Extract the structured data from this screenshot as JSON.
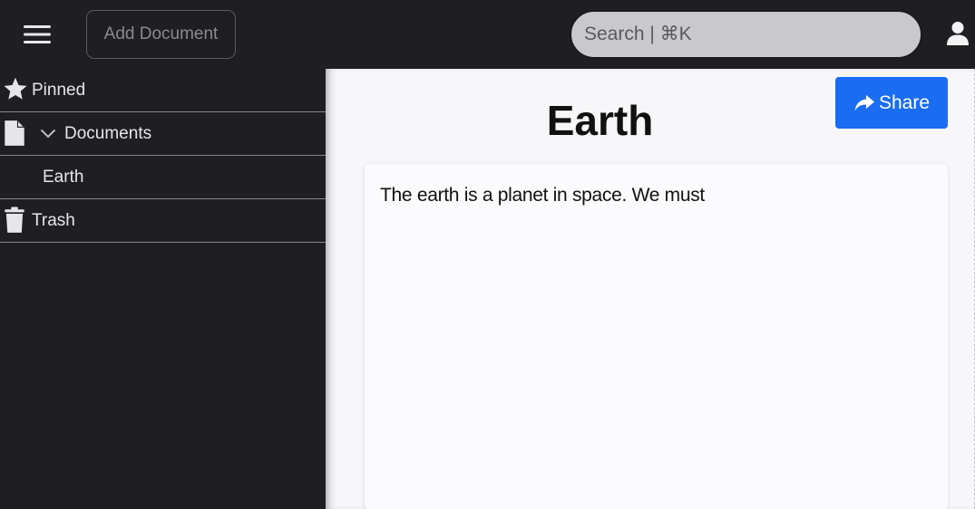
{
  "topbar": {
    "menu_icon": "hamburger-menu-icon",
    "add_document_label": "Add Document",
    "search_placeholder": "Search | ⌘K",
    "user_icon": "user-icon"
  },
  "sidebar": {
    "items": [
      {
        "icon": "star-icon",
        "label": "Pinned"
      },
      {
        "icon": "document-icon",
        "label": "Documents",
        "chevron": "chevron-down-icon",
        "expanded": true
      },
      {
        "label": "Earth",
        "child": true
      },
      {
        "icon": "trash-icon",
        "label": "Trash"
      }
    ]
  },
  "document": {
    "title": "Earth",
    "share_label": "Share",
    "share_icon": "share-arrow-icon",
    "body": "The earth is a planet in space. We must"
  },
  "colors": {
    "background_dark": "#1f1e21",
    "content_background": "#f7f6f9",
    "share_button": "#1a6cf2",
    "search_field": "#c9c8cc",
    "sidebar_text": "#e6e6e8"
  }
}
